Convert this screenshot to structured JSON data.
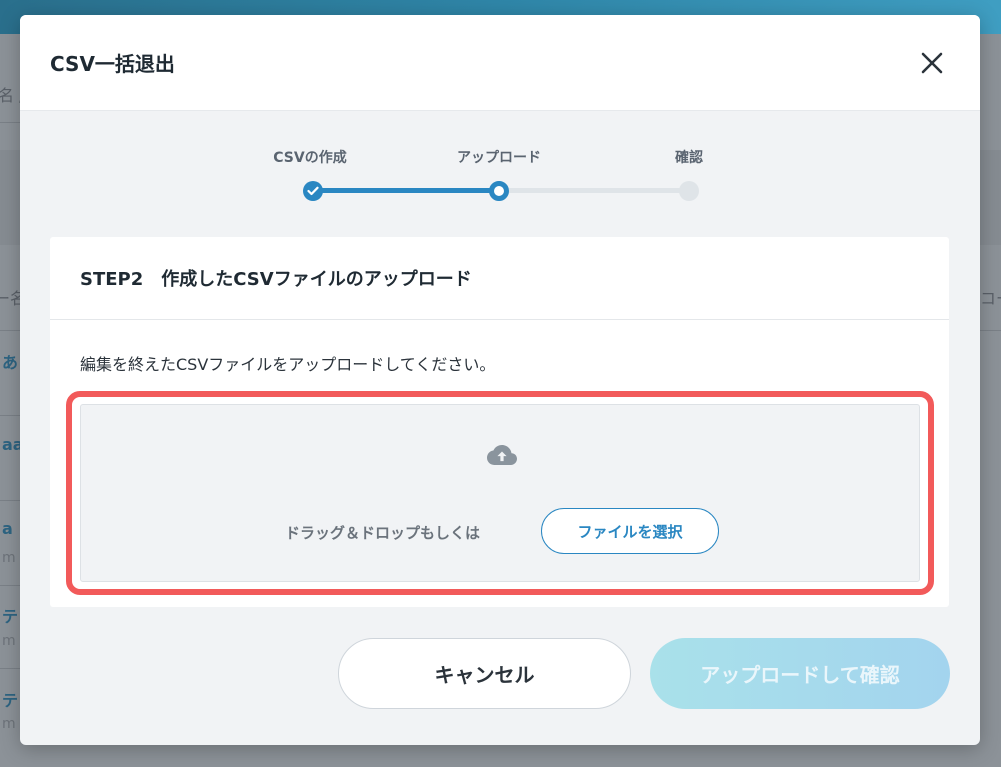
{
  "background": {
    "rows": [
      {
        "left": "名 /",
        "right": ""
      },
      {
        "left": "ー名",
        "right": "コー"
      },
      {
        "left": "あ",
        "right": ""
      },
      {
        "left": "aa",
        "right": ""
      },
      {
        "left": "a",
        "right": ""
      },
      {
        "left": "m",
        "right": ""
      },
      {
        "left": "テ",
        "right": ""
      },
      {
        "left": "m",
        "right": ""
      },
      {
        "left": "テ",
        "right": ""
      },
      {
        "left": "m",
        "right": ""
      }
    ]
  },
  "modal": {
    "title": "CSV一括退出",
    "close_icon": "close-icon"
  },
  "stepper": {
    "steps": [
      {
        "label": "CSVの作成",
        "state": "done"
      },
      {
        "label": "アップロード",
        "state": "current"
      },
      {
        "label": "確認",
        "state": "todo"
      }
    ]
  },
  "card": {
    "title": "STEP2　作成したCSVファイルのアップロード",
    "description": "編集を終えたCSVファイルをアップロードしてください。",
    "dropzone": {
      "icon": "cloud-upload-icon",
      "text": "ドラッグ＆ドロップもしくは",
      "button_label": "ファイルを選択"
    }
  },
  "footer": {
    "cancel_label": "キャンセル",
    "confirm_label": "アップロードして確認"
  },
  "colors": {
    "accent": "#2a87c2",
    "highlight": "#f25a5a",
    "confirm_disabled": "#a6dbec"
  }
}
